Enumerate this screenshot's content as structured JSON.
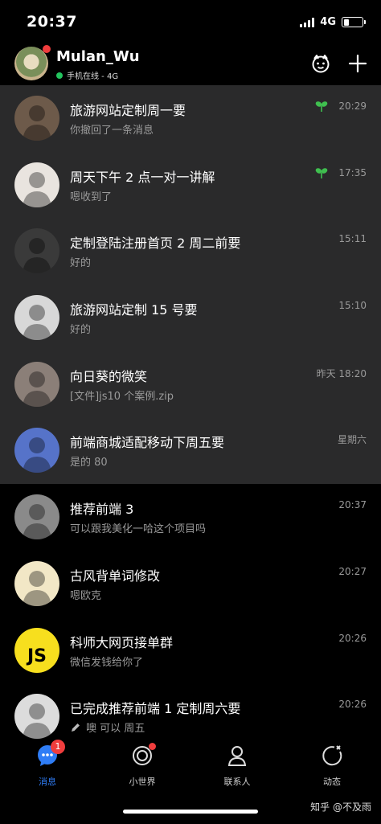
{
  "status": {
    "time": "20:37",
    "network": "4G",
    "battery_level": 0.3
  },
  "header": {
    "username": "Mulan_Wu",
    "status_text": "手机在线 - 4G"
  },
  "chats": [
    {
      "name": "旅游网站定制周一要",
      "message": "你撤回了一条消息",
      "time": "20:29",
      "pinned": true,
      "leaf": true,
      "avatar_color": "#6d5a4a"
    },
    {
      "name": "周天下午 2 点一对一讲解",
      "message": "嗯收到了",
      "time": "17:35",
      "pinned": true,
      "leaf": true,
      "avatar_color": "#e9e4df"
    },
    {
      "name": "定制登陆注册首页 2 周二前要",
      "message": "好的",
      "time": "15:11",
      "pinned": true,
      "leaf": false,
      "avatar_color": "#3a3a3a"
    },
    {
      "name": "旅游网站定制 15 号要",
      "message": "好的",
      "time": "15:10",
      "pinned": true,
      "leaf": false,
      "avatar_color": "#d8d8d8"
    },
    {
      "name": "向日葵的微笑",
      "message": "[文件]js10 个案例.zip",
      "time": "昨天 18:20",
      "pinned": true,
      "leaf": false,
      "avatar_color": "#8b7f78"
    },
    {
      "name": "前端商城适配移动下周五要",
      "message": "是的 80",
      "time": "星期六",
      "pinned": true,
      "leaf": false,
      "avatar_color": "#5673c9"
    },
    {
      "name": "推荐前端 3",
      "message": "可以跟我美化一哈这个项目吗",
      "time": "20:37",
      "pinned": false,
      "leaf": false,
      "avatar_color": "#8a8a8a"
    },
    {
      "name": "古风背单词修改",
      "message": "嗯欧克",
      "time": "20:27",
      "pinned": false,
      "leaf": false,
      "avatar_color": "#f2e7c6"
    },
    {
      "name": "科师大网页接单群",
      "message": "微信发钱给你了",
      "time": "20:26",
      "pinned": false,
      "leaf": false,
      "avatar_color": "#f7df1e",
      "avatar_text": "JS"
    },
    {
      "name": "已完成推荐前端 1 定制周六要",
      "message": "噢 可以 周五",
      "time": "20:26",
      "pinned": false,
      "leaf": false,
      "draft": true,
      "avatar_color": "#dcdcdc"
    }
  ],
  "tabs": [
    {
      "label": "消息",
      "icon": "message-icon",
      "active": true,
      "badge": "1"
    },
    {
      "label": "小世界",
      "icon": "small-world-icon",
      "active": false,
      "dot": true
    },
    {
      "label": "联系人",
      "icon": "contacts-icon",
      "active": false
    },
    {
      "label": "动态",
      "icon": "moments-icon",
      "active": false
    }
  ],
  "watermark": "知乎 @不及雨",
  "colors": {
    "accent": "#2f7df6",
    "badge": "#f03d3d",
    "online": "#23c45e",
    "pinned_bg": "#2a2a2b",
    "leaf": "#3fbf4f"
  }
}
